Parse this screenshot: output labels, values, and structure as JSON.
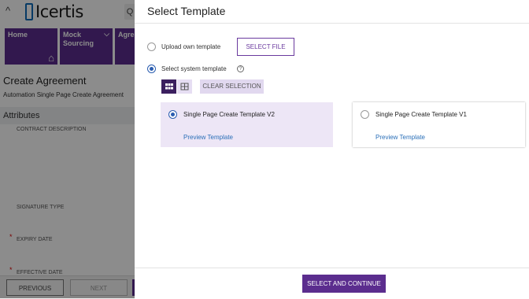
{
  "app": {
    "logo_text": "Icertis",
    "tiles": [
      {
        "label": "Home"
      },
      {
        "label": "Mock Sourcing"
      },
      {
        "label": "Agre"
      }
    ],
    "page_title": "Create Agreement",
    "page_subtitle": "Automation Single Page Create Agreement",
    "section_title": "Attributes",
    "fields": [
      "CONTRACT DESCRIPTION",
      "SIGNATURE TYPE",
      "EXPIRY DATE",
      "EFFECTIVE DATE"
    ],
    "footer": {
      "previous": "PREVIOUS",
      "next": "NEXT"
    }
  },
  "modal": {
    "title": "Select Template",
    "upload_option": "Upload own template",
    "select_file": "SELECT FILE",
    "system_option": "Select system template",
    "clear_selection": "CLEAR SELECTION",
    "templates": [
      {
        "name": "Single Page Create Template V2",
        "preview": "Preview Template",
        "selected": true
      },
      {
        "name": "Single Page Create Template V1",
        "preview": "Preview Template",
        "selected": false
      }
    ],
    "primary_button": "SELECT AND CONTINUE"
  },
  "colors": {
    "brand": "#5b2d8e",
    "link": "#2a6fb8",
    "selected_card": "#ede6f6"
  }
}
